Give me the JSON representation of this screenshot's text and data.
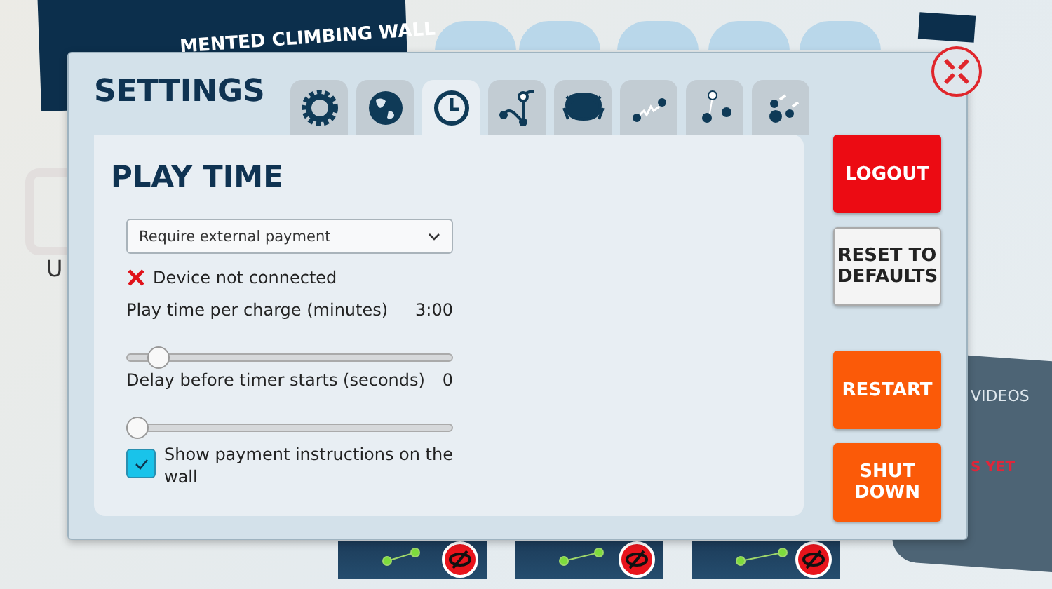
{
  "background": {
    "banner_title": "MENTED CLIMBING WALL",
    "side_label": "U",
    "videos_panel": {
      "title": "VIDEOS",
      "message": "S YET"
    },
    "thumbnails": [
      {
        "hidden": true
      },
      {
        "hidden": true
      },
      {
        "hidden": true
      }
    ]
  },
  "settings": {
    "title": "SETTINGS",
    "tabs": [
      {
        "selected": false
      },
      {
        "selected": false
      },
      {
        "selected": true
      },
      {
        "selected": false
      },
      {
        "selected": false
      },
      {
        "selected": false
      },
      {
        "selected": false
      },
      {
        "selected": false
      }
    ],
    "panel": {
      "heading": "PLAY TIME",
      "payment_mode": "Require external payment",
      "device_status": {
        "text": "Device not connected",
        "connected": false
      },
      "sliders": [
        {
          "label": "Play time per charge (minutes)",
          "reading": "3:00",
          "level": 0.07
        },
        {
          "label": "Delay before timer starts (seconds)",
          "reading": "0",
          "level": 0
        }
      ],
      "checkbox": {
        "label": "Show payment instructions on the wall",
        "checked": true
      }
    },
    "buttons": [
      {
        "label": "LOGOUT",
        "kind": "danger"
      },
      {
        "label": "RESET TO DEFAULTS",
        "kind": "plain"
      },
      {
        "label": "RESTART",
        "kind": "warning"
      },
      {
        "label": "SHUT DOWN",
        "kind": "warning"
      }
    ]
  }
}
